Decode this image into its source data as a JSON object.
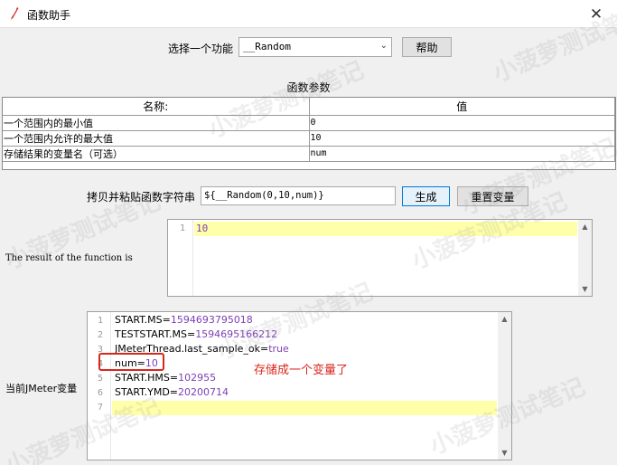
{
  "window": {
    "title": "函数助手",
    "icon": "feather-pen-icon",
    "close_glyph": "✕"
  },
  "function_select": {
    "label": "选择一个功能",
    "value": "__Random",
    "caret": "⌄"
  },
  "help_button": "帮助",
  "params": {
    "title": "函数参数",
    "headers": {
      "name": "名称:",
      "value": "值"
    },
    "rows": [
      {
        "name": "一个范围内的最小值",
        "value": "0"
      },
      {
        "name": "一个范围内允许的最大值",
        "value": "10"
      },
      {
        "name": "存储结果的变量名（可选）",
        "value": "num"
      }
    ]
  },
  "copy": {
    "label": "拷贝并粘贴函数字符串",
    "value": "${__Random(0,10,num)}"
  },
  "generate_button": "生成",
  "reset_button": "重置变量",
  "result": {
    "label": "The result of the function is",
    "line_numbers": [
      "1"
    ],
    "value": "10"
  },
  "vars": {
    "label": "当前JMeter变量",
    "line_numbers": [
      "1",
      "2",
      "3",
      "4",
      "5",
      "6",
      "7"
    ],
    "lines": [
      {
        "key": "START.MS=",
        "val": "1594693795018"
      },
      {
        "key": "TESTSTART.MS=",
        "val": "1594695166212"
      },
      {
        "key": "JMeterThread.last_sample_ok=",
        "val": "true"
      },
      {
        "key": "num=",
        "val": "10"
      },
      {
        "key": "START.HMS=",
        "val": "102955"
      },
      {
        "key": "START.YMD=",
        "val": "20200714"
      }
    ]
  },
  "annotation": {
    "text": "存储成一个变量了",
    "color": "#d9261c"
  },
  "watermark": "小菠萝测试笔记",
  "colors": {
    "highlight": "#ffffaa",
    "value": "#7d3fb5",
    "focus_border": "#0078d7"
  }
}
